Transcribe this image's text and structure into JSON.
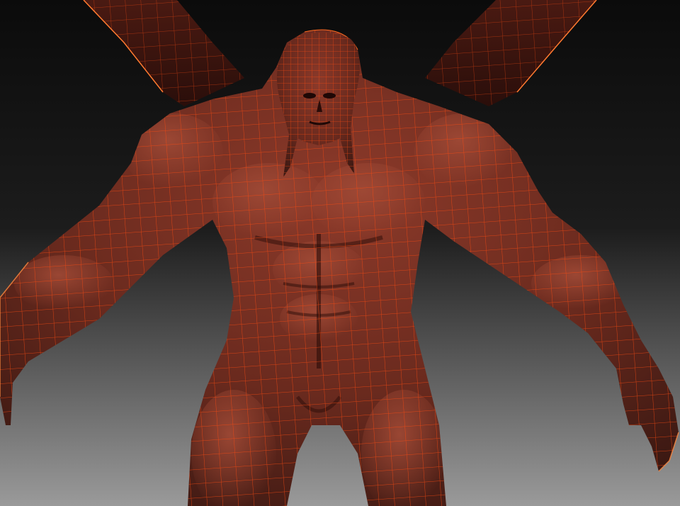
{
  "viewport": {
    "background_top": "#0b0b0b",
    "background_bottom": "#9a9a9a"
  },
  "model": {
    "skin_dark": "#3a1812",
    "skin_mid": "#6a2a1e",
    "skin_light": "#8c3a2a",
    "wire_color": "#ff4a10"
  }
}
